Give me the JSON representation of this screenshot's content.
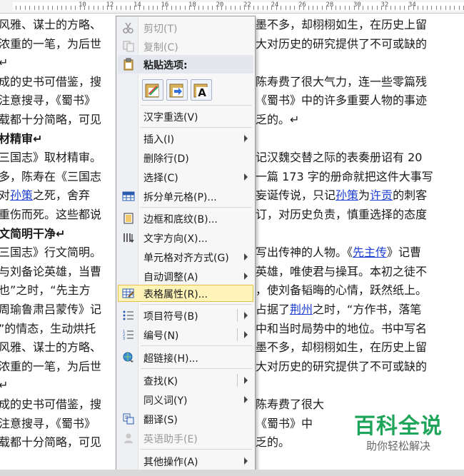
{
  "ruler": {
    "numbers": [
      "10",
      "12",
      "14",
      "16",
      "18",
      "20",
      "22",
      "24",
      "26",
      "28",
      "30",
      "32",
      "34"
    ]
  },
  "document": {
    "lines": [
      {
        "text": "风雅、谋士的方略、",
        "right": "墨不多，却栩栩如生，在历史上留"
      },
      {
        "text": "浓重的一笔，为后世",
        "right": "大对历史的研究提供了不可或缺的"
      },
      {
        "text": "↵",
        "right": ""
      },
      {
        "text": "成的史书可借鉴，搜",
        "right": "陈寿费了很大气力，连一些零篇残"
      },
      {
        "text": "注意搜寻，《蜀书》",
        "right": "《蜀书》中的许多重要人物的事迹"
      },
      {
        "text": "载都十分简略，可见",
        "right": "乏的。↵"
      },
      {
        "text": "材精审↵",
        "right": "",
        "bold": true
      },
      {
        "text": "三国志》取材精审。",
        "right": "记汉魏交替之际的表奏册诏有 20"
      },
      {
        "text": "多，陈寿在《三国志",
        "right": "一篇 173 字的册命就把这件大事写"
      },
      {
        "text": " 对孙策之死，舍弃",
        "right": "妄诞传说，只记孙策为许贡的刺客"
      },
      {
        "text": "重伤而死。这些都说",
        "right": "订，对历史负责，慎重选择的态度"
      },
      {
        "text": "文简明干净↵",
        "right": "",
        "bold": true
      },
      {
        "text": "三国志》行文简明。",
        "right": "写出传神的人物。《先主传》记曹"
      },
      {
        "text": "与刘备论英雄，当曹",
        "right": "英雄，唯使君与操耳。本初之徒不"
      },
      {
        "text": "也”之时，“先主方",
        "right": "，使刘备韬晦的心情，跃然纸上。"
      },
      {
        "text": "周瑜鲁肃吕蒙传》记",
        "right": "占据了荆州之时，“方作书，落笔"
      },
      {
        "text": "”的情态，生动烘托",
        "right": "中和当时局势中的地位。书中写名"
      },
      {
        "text": "风雅、谋士的方略、",
        "right": "墨不多，却栩栩如生，在历史上留"
      },
      {
        "text": "浓重的一笔，为后世",
        "right": "大对历史的研究提供了不可或缺的"
      },
      {
        "text": "↵",
        "right": ""
      },
      {
        "text": "成的史书可借鉴，搜",
        "right": "陈寿费了很大"
      },
      {
        "text": "注意搜寻，《蜀书》",
        "right": "《蜀书》中"
      },
      {
        "text": "载都十分简略，可见",
        "right": "乏的。"
      }
    ]
  },
  "menu": {
    "cut": "剪切(T)",
    "copy": "复制(C)",
    "paste_options": "粘贴选项:",
    "reselect": "汉字重选(V)",
    "insert": "插入(I)",
    "delete_row": "删除行(D)",
    "select": "选择(C)",
    "split_cells": "拆分单元格(P)...",
    "borders": "边框和底纹(B)...",
    "text_direction": "文字方向(X)...",
    "cell_alignment": "单元格对齐方式(G)",
    "autofit": "自动调整(A)",
    "table_properties": "表格属性(R)...",
    "bullets": "项目符号(B)",
    "numbering": "编号(N)",
    "hyperlink": "超链接(H)...",
    "lookup": "查找(K)",
    "synonyms": "同义词(Y)",
    "translate": "翻译(S)",
    "english_assistant": "英语助手(E)",
    "other_actions": "其他操作(A)"
  },
  "watermark": {
    "title": "百科全说",
    "subtitle": "助你轻松解决"
  }
}
